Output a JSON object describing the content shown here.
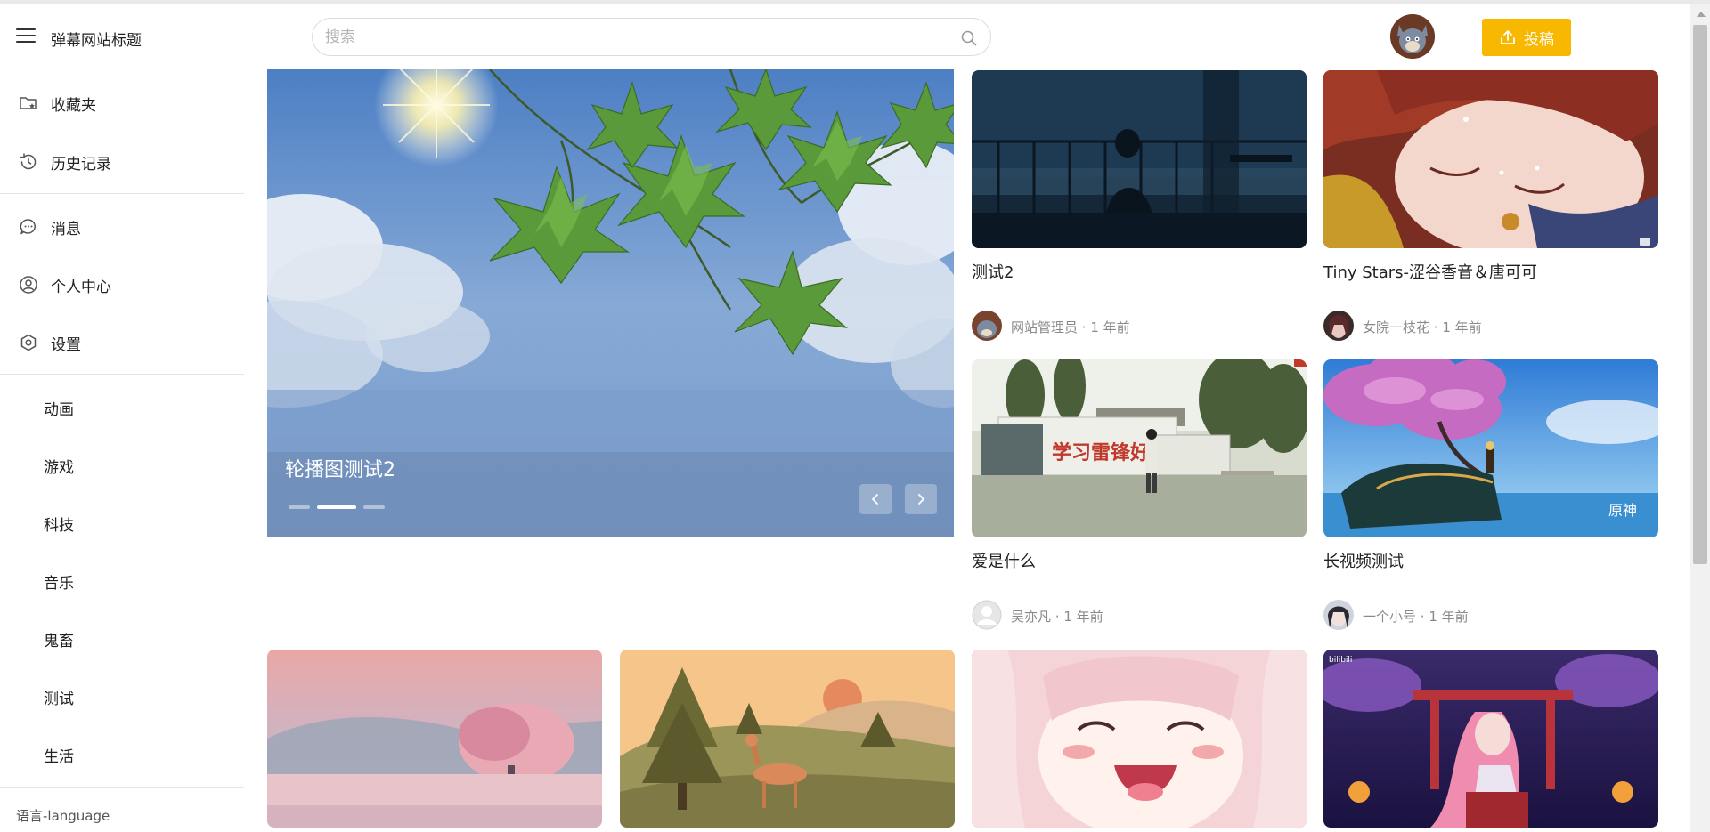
{
  "header": {
    "site_title": "弹幕网站标题",
    "search_placeholder": "搜索",
    "upload_label": "投稿"
  },
  "sidebar": {
    "nav": [
      {
        "label": "收藏夹",
        "icon": "folder-star-icon"
      },
      {
        "label": "历史记录",
        "icon": "history-clock-icon"
      },
      {
        "label": "消息",
        "icon": "chat-bubble-icon"
      },
      {
        "label": "个人中心",
        "icon": "user-circle-icon"
      },
      {
        "label": "设置",
        "icon": "settings-hexagon-icon"
      }
    ],
    "categories": [
      "动画",
      "游戏",
      "科技",
      "音乐",
      "鬼畜",
      "测试",
      "生活"
    ],
    "language_label": "语言-language"
  },
  "carousel": {
    "title": "轮播图测试2",
    "slide_count": 3,
    "active_slide": 2
  },
  "videos": [
    {
      "title": "测试2",
      "author": "网站管理员",
      "time": "1 年前"
    },
    {
      "title": "Tiny Stars-涩谷香音＆唐可可",
      "author": "女院一枝花",
      "time": "1 年前"
    },
    {
      "title": "爱是什么",
      "author": "吴亦凡",
      "time": "1 年前"
    },
    {
      "title": "长视频测试",
      "author": "一个小号",
      "time": "1 年前"
    }
  ],
  "colors": {
    "accent": "#f9b800",
    "text": "#222222",
    "muted": "#8a8a8a",
    "divider": "#e4e4e4"
  }
}
